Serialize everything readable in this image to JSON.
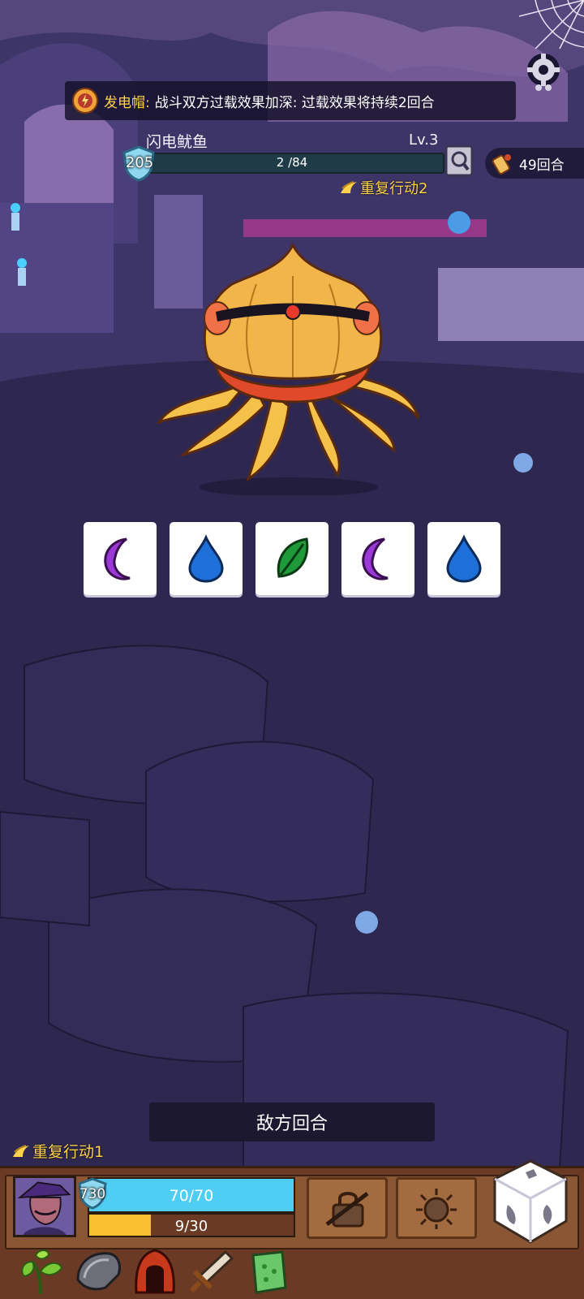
{
  "banner": {
    "item_name": "发电帽:",
    "description": "战斗双方过载效果加深: 过载效果将持续2回合"
  },
  "enemy": {
    "name": "闪电鱿鱼",
    "level": "Lv.3",
    "shield": "205",
    "hp_text": "2 /84",
    "hp_fraction": 0.024,
    "repeat_action": "重复行动2"
  },
  "turn_counter": "49回合",
  "dice_faces": [
    {
      "icon": "moon-icon",
      "color": "#9a38d8"
    },
    {
      "icon": "water-drop-icon",
      "color": "#1f6fd8"
    },
    {
      "icon": "leaf-icon",
      "color": "#1e9a3a"
    },
    {
      "icon": "moon-icon",
      "color": "#9a38d8"
    },
    {
      "icon": "water-drop-icon",
      "color": "#1f6fd8"
    }
  ],
  "status": {
    "enemy_turn": "敌方回合"
  },
  "player": {
    "repeat_action": "重复行动1",
    "shield": "730",
    "hp_text": "70/70",
    "hp_fraction": 1.0,
    "xp_text": "9/30",
    "xp_fraction": 0.3
  },
  "skills": [
    "locked-skill-icon",
    "bomb-skill-icon"
  ],
  "items": [
    "sprout-icon",
    "shoulder-armor-icon",
    "red-hood-icon",
    "sword-icon",
    "green-scroll-icon"
  ],
  "colors": {
    "accent_yellow": "#ffd24a",
    "hp_blue": "#4fcdf3",
    "xp_yellow": "#f8c02e",
    "panel_brown": "#6b3a24"
  }
}
